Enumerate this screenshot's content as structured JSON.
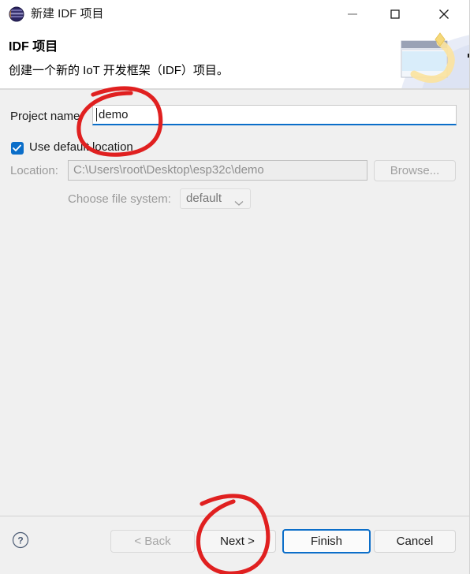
{
  "window": {
    "title": "新建 IDF 项目",
    "app_icon": "eclipse-logo-icon",
    "controls": {
      "minimize": "minimize-icon",
      "maximize": "maximize-icon",
      "close": "close-icon"
    }
  },
  "header": {
    "title": "IDF 项目",
    "description": "创建一个新的 IoT 开发框架（IDF）项目。",
    "graphic": "new-project-wizard-banner-icon"
  },
  "form": {
    "project_name": {
      "label": "Project name:",
      "value": "demo",
      "placeholder": ""
    },
    "use_default_location": {
      "label": "Use default location",
      "checked": true
    },
    "location": {
      "label": "Location:",
      "value": "C:\\Users\\root\\Desktop\\esp32c\\demo",
      "enabled": false
    },
    "browse_button": {
      "label": "Browse...",
      "enabled": false
    },
    "file_system": {
      "label": "Choose file system:",
      "selected": "default",
      "options": [
        "default"
      ],
      "enabled": false
    }
  },
  "footer": {
    "help": "?",
    "back": "< Back",
    "next": "Next >",
    "finish": "Finish",
    "cancel": "Cancel"
  },
  "annotations": {
    "project_name_circle": "red-hand-drawn-ellipse",
    "next_button_circle": "red-hand-drawn-ellipse"
  },
  "colors": {
    "accent": "#0b6ec9",
    "annotation": "#e02020",
    "content_bg": "#f0f0f0",
    "text": "#1b1b1b",
    "disabled_text": "#9a9a9a"
  }
}
